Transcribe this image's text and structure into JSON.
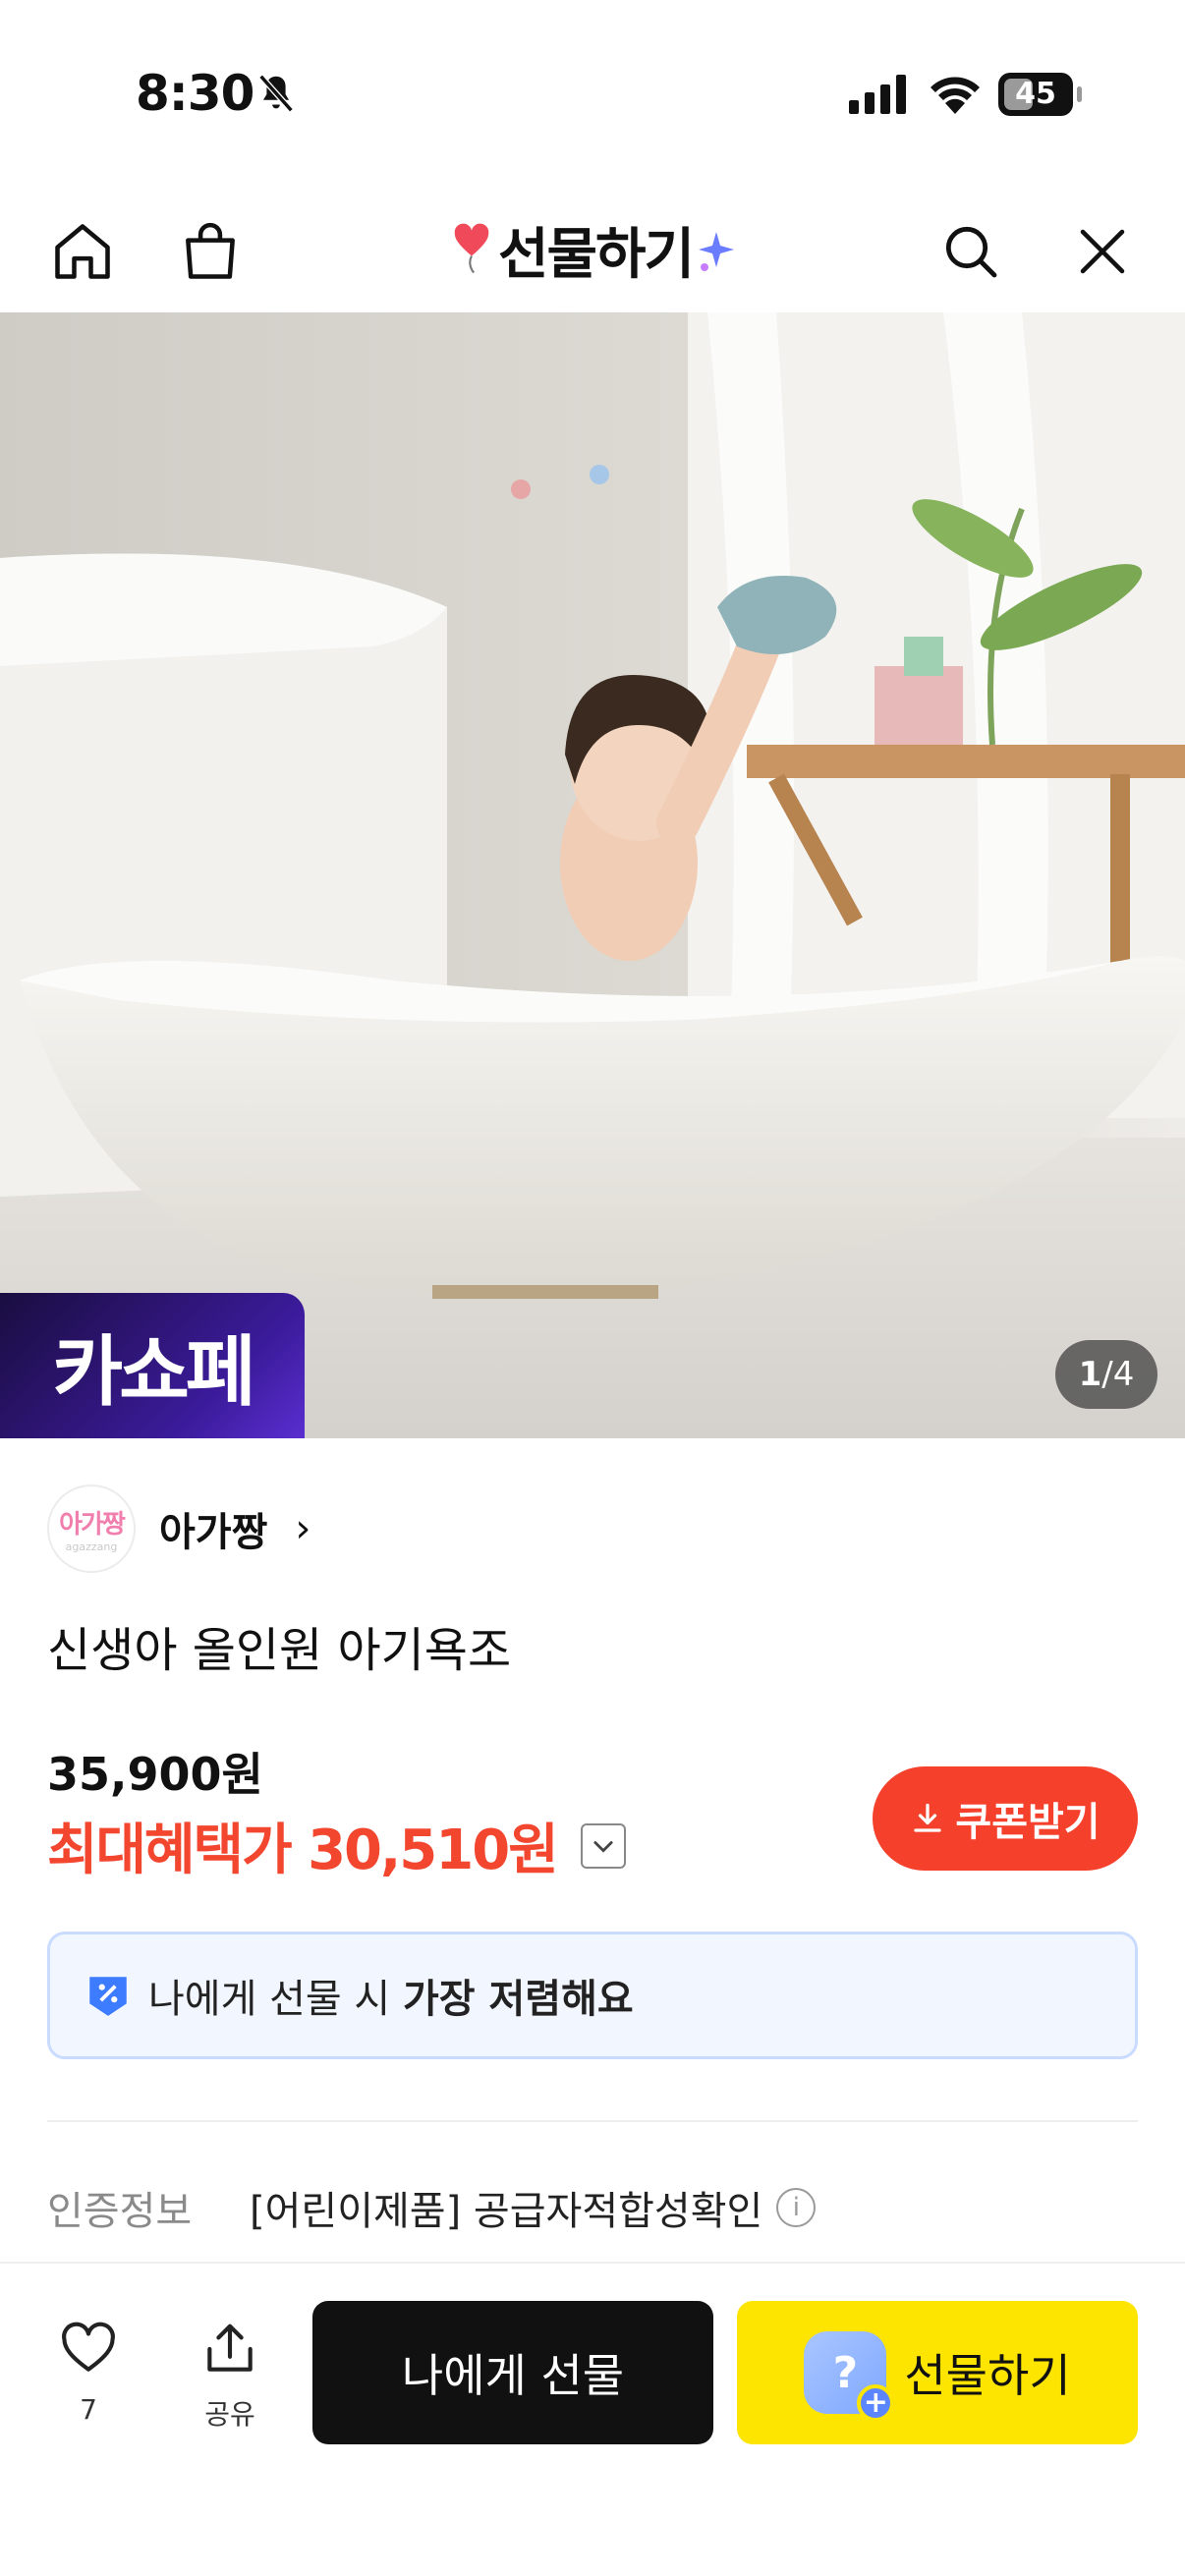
{
  "status_bar": {
    "time": "8:30",
    "battery": "45",
    "battery_fraction": 0.45
  },
  "header": {
    "title": "선물하기",
    "icons": [
      "home-icon",
      "shopping-bag-icon",
      "search-icon",
      "close-icon"
    ]
  },
  "hero": {
    "logo_text": "카쇼페",
    "page_current": "1",
    "page_total": "/4"
  },
  "seller": {
    "logo_ko": "아가짱",
    "logo_en": "agazzang",
    "name": "아가짱",
    "chevron": "›"
  },
  "product": {
    "name": "신생아 올인원 아기욕조",
    "price": "35,900원",
    "max_benefit_label": "최대혜택가 30,510원"
  },
  "coupon": {
    "label": "쿠폰받기"
  },
  "notice": {
    "prefix": "나에게 선물 시 ",
    "emphasis": "가장 저렴해요"
  },
  "certification": {
    "label": "인증정보",
    "value": "[어린이제품] 공급자적합성확인",
    "info_glyph": "i"
  },
  "bottom_bar": {
    "like_count": "7",
    "share_label": "공유",
    "self_gift_label": "나에게 선물",
    "gift_label": "선물하기",
    "gift_badge": "?",
    "gift_plus": "+"
  },
  "colors": {
    "accent_red": "#f5402c",
    "kakao_yellow": "#fee500",
    "notice_bg": "#f2f7ff",
    "notice_border": "#c9dbff"
  }
}
